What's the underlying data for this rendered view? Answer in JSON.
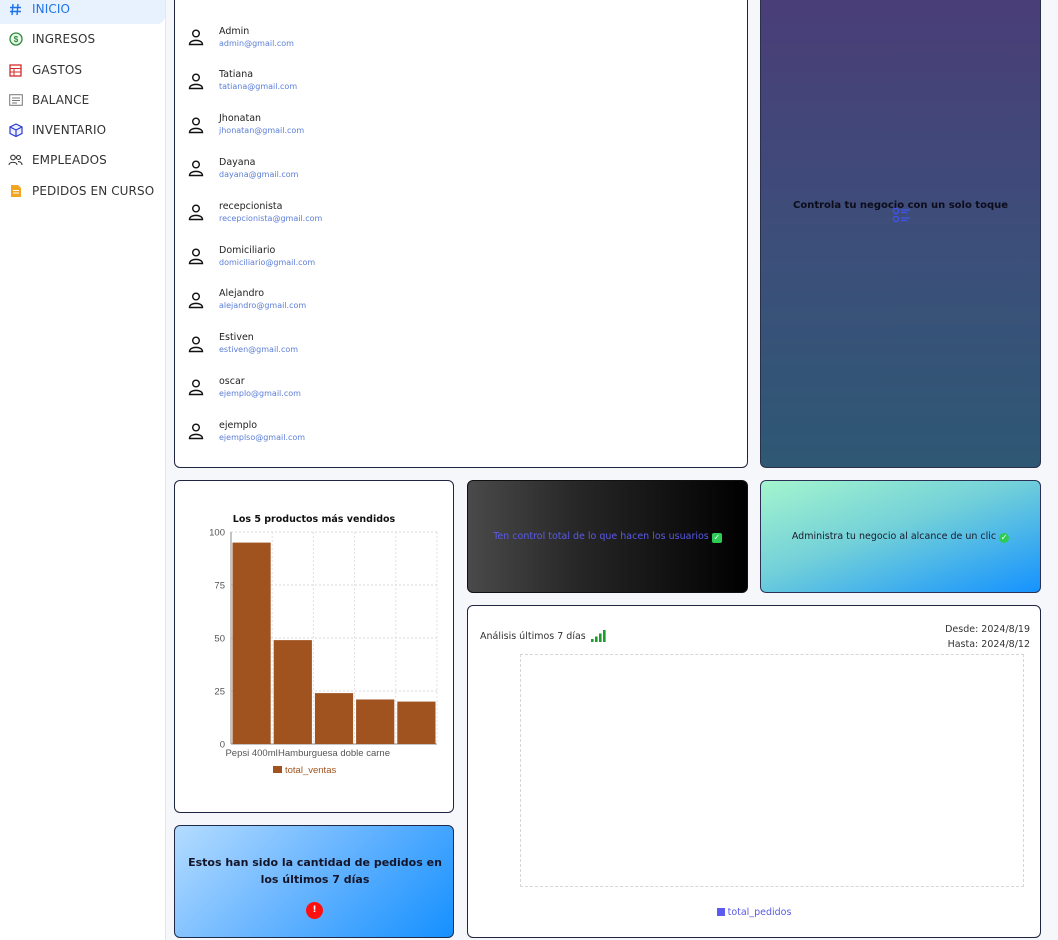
{
  "sidebar": {
    "items": [
      {
        "label": "INICIO",
        "icon": "hash-icon",
        "active": true
      },
      {
        "label": "INGRESOS",
        "icon": "dollar-coin-icon"
      },
      {
        "label": "GASTOS",
        "icon": "spreadsheet-icon"
      },
      {
        "label": "BALANCE",
        "icon": "document-lines-icon"
      },
      {
        "label": "INVENTARIO",
        "icon": "cube-icon"
      },
      {
        "label": "EMPLEADOS",
        "icon": "people-icon"
      },
      {
        "label": "PEDIDOS EN CURSO",
        "icon": "file-icon"
      }
    ]
  },
  "users": [
    {
      "name": "Admin",
      "email": "admin@gmail.com"
    },
    {
      "name": "Tatiana",
      "email": "tatiana@gmail.com"
    },
    {
      "name": "Jhonatan",
      "email": "jhonatan@gmail.com"
    },
    {
      "name": "Dayana",
      "email": "dayana@gmail.com"
    },
    {
      "name": "recepcionista",
      "email": "recepcionista@gmail.com"
    },
    {
      "name": "Domiciliario",
      "email": "domiciliario@gmail.com"
    },
    {
      "name": "Alejandro",
      "email": "alejandro@gmail.com"
    },
    {
      "name": "Estiven",
      "email": "estiven@gmail.com"
    },
    {
      "name": "oscar",
      "email": "ejemplo@gmail.com"
    },
    {
      "name": "ejemplo",
      "email": "ejemplso@gmail.com"
    }
  ],
  "promo": {
    "text": "Controla tu negocio con un solo toque",
    "icon": "checklist-icon"
  },
  "dark_card": {
    "text": "Ten control total de lo que hacen los usuarios",
    "check": "✓"
  },
  "green_card": {
    "text": "Administra tu negocio al alcance de un clic",
    "check": "✓"
  },
  "orders_card": {
    "text": "Estos han sido la cantidad de pedidos en los últimos 7 días",
    "alert": "!"
  },
  "analysis": {
    "title": "Análisis últimos 7 días",
    "desde": "Desde: 2024/8/19",
    "hasta": "Hasta: 2024/8/12",
    "legend": "total_pedidos",
    "legend_color": "#5b5bf0"
  },
  "chart_data": {
    "type": "bar",
    "title": "Los 5 productos más vendidos",
    "categories": [
      "Pepsi 400ml",
      "",
      "Hamburguesa doble carne",
      "",
      ""
    ],
    "tick_labels_shown": [
      "Pepsi 400ml",
      "Hamburguesa doble carne"
    ],
    "series": [
      {
        "name": "total_ventas",
        "values": [
          95,
          49,
          24,
          21,
          20
        ],
        "color": "#a0521f"
      }
    ],
    "ylim": [
      0,
      100
    ],
    "yticks": [
      0,
      25,
      50,
      75,
      100
    ],
    "grid": true,
    "legend": "bottom"
  }
}
